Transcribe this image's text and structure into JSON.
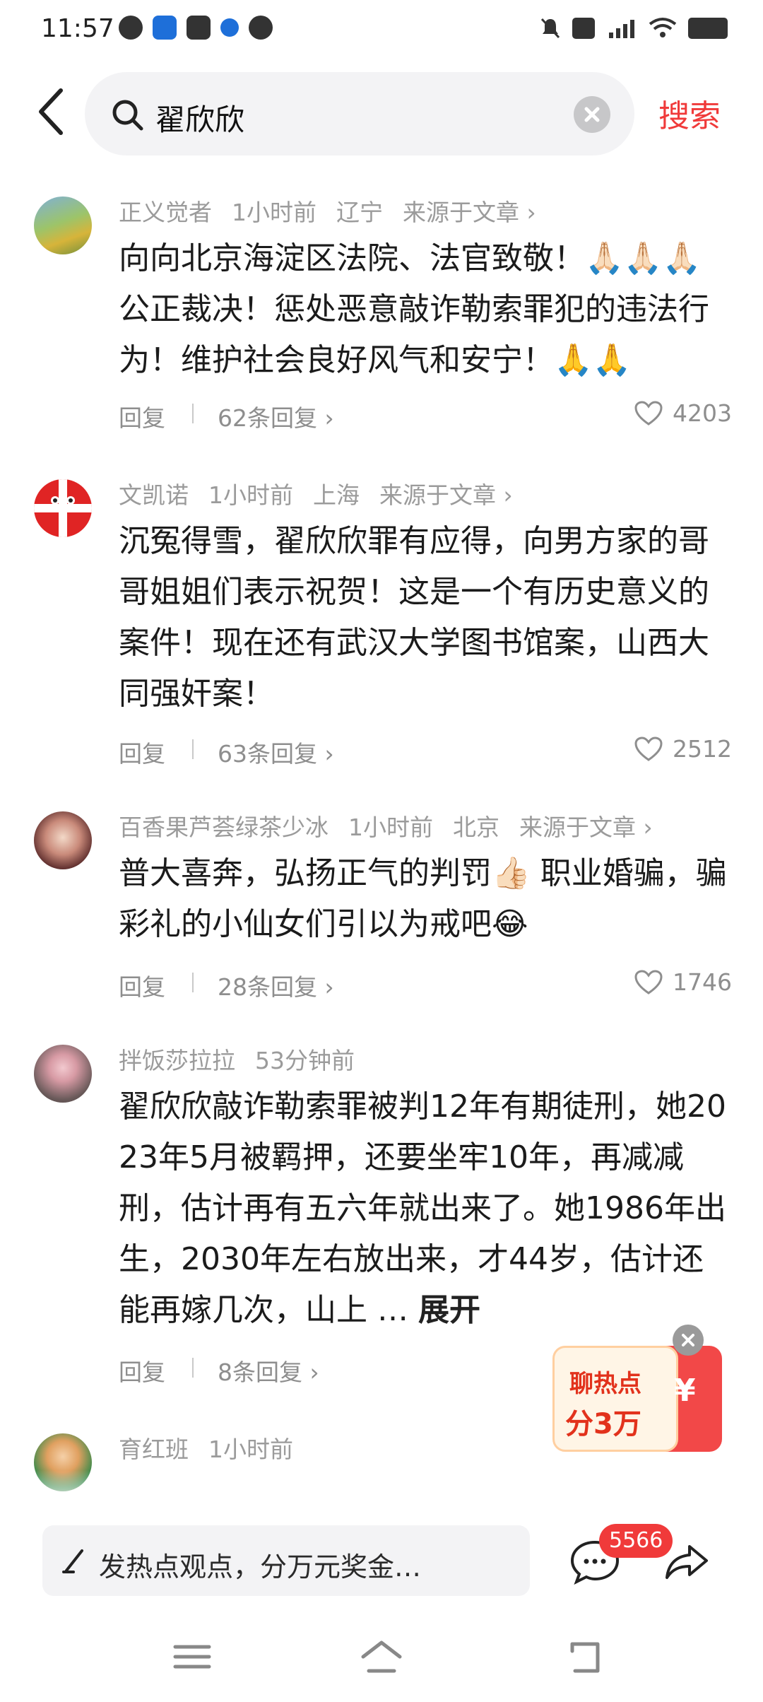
{
  "status_bar": {
    "time": "11:57"
  },
  "search": {
    "query": "翟欣欣",
    "submit_label": "搜索"
  },
  "comments": [
    {
      "author": "正义觉者",
      "time": "1小时前",
      "location": "辽宁",
      "source": "来源于文章 ›",
      "text": "向向北京海淀区法院、法官致敬！🙏🏻🙏🏻🙏🏻公正裁决！惩处恶意敲诈勒索罪犯的违法行为！维护社会良好风气和安宁！🙏🙏",
      "reply_label": "回复",
      "replies_label": "62条回复 ›",
      "likes": "4203"
    },
    {
      "author": "文凯诺",
      "time": "1小时前",
      "location": "上海",
      "source": "来源于文章 ›",
      "text": "沉冤得雪，翟欣欣罪有应得，向男方家的哥哥姐姐们表示祝贺！这是一个有历史意义的案件！现在还有武汉大学图书馆案，山西大同强奸案！",
      "reply_label": "回复",
      "replies_label": "63条回复 ›",
      "likes": "2512"
    },
    {
      "author": "百香果芦荟绿茶少冰",
      "time": "1小时前",
      "location": "北京",
      "source": "来源于文章 ›",
      "text": "普大喜奔，弘扬正气的判罚👍🏻 职业婚骗，骗彩礼的小仙女们引以为戒吧😂",
      "reply_label": "回复",
      "replies_label": "28条回复 ›",
      "likes": "1746"
    },
    {
      "author": "拌饭莎拉拉",
      "time": "53分钟前",
      "text": "翟欣欣敲诈勒索罪被判12年有期徒刑，她2023年5月被羁押，还要坐牢10年，再减减刑，估计再有五六年就出来了。她1986年出生，2030年左右放出来，才44岁，估计还能再嫁几次，山上 …",
      "expand_label": "展开",
      "reply_label": "回复",
      "replies_label": "8条回复 ›"
    },
    {
      "author": "育红班",
      "time": "1小时前"
    }
  ],
  "promo": {
    "line1": "聊热点",
    "line2": "分3万",
    "currency": "¥"
  },
  "bottom_bar": {
    "input_placeholder": "发热点观点，分万元奖金…",
    "comment_count": "5566"
  },
  "colors": {
    "accent_red": "#f03a3a",
    "meta_gray": "#9b9b9b"
  }
}
